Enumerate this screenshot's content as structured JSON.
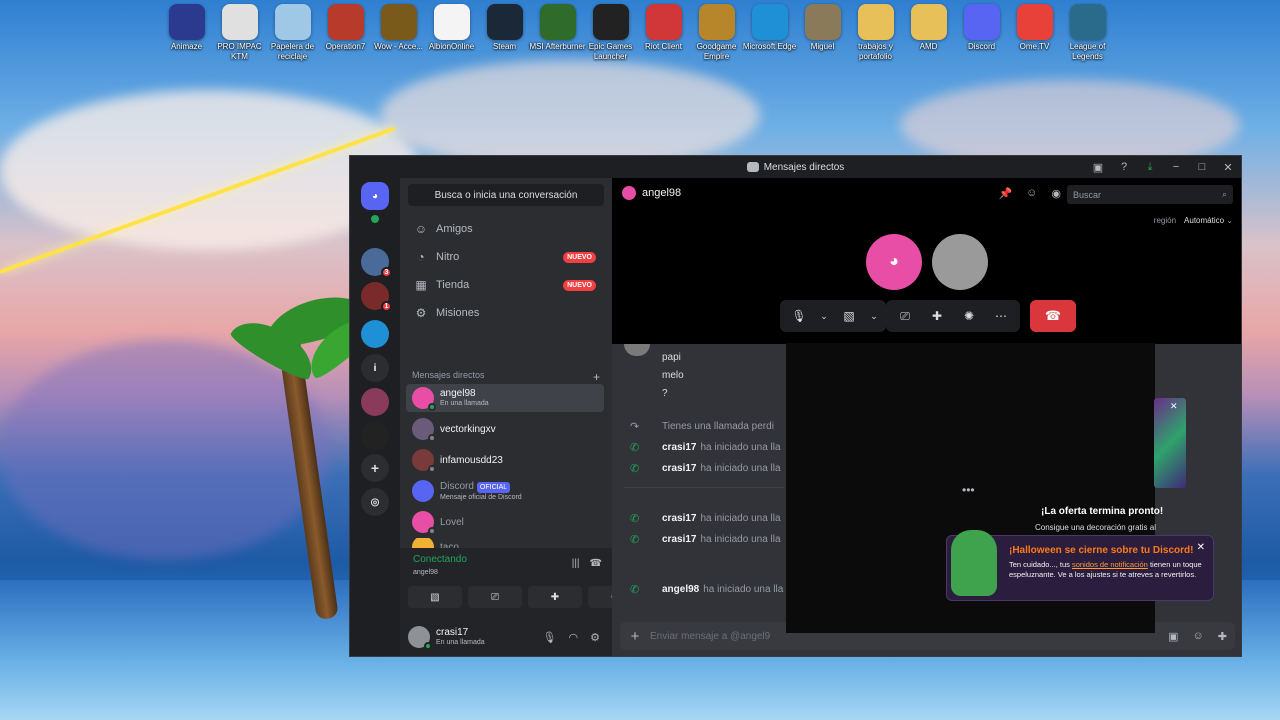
{
  "desktop_icons": [
    {
      "label": "Animaze",
      "icon": "animaze-icon",
      "color": "#2b3a8f"
    },
    {
      "label": "PRO IMPAC KTM",
      "icon": "document-icon",
      "color": "#e0e0e0"
    },
    {
      "label": "Papelera de reciclaje",
      "icon": "recycle-bin-icon",
      "color": "#9fc7e6"
    },
    {
      "label": "Operation7",
      "icon": "operation7-icon",
      "color": "#b83a2a"
    },
    {
      "label": "Wow - Acce...",
      "icon": "wow-icon",
      "color": "#7a5a1a"
    },
    {
      "label": "AlbionOnline",
      "icon": "file-icon",
      "color": "#f4f4f4"
    },
    {
      "label": "Steam",
      "icon": "steam-icon",
      "color": "#1b2838"
    },
    {
      "label": "MSI Afterburner",
      "icon": "msi-icon",
      "color": "#2f6b2a"
    },
    {
      "label": "Epic Games Launcher",
      "icon": "epic-icon",
      "color": "#222222"
    },
    {
      "label": "Riot Client",
      "icon": "riot-icon",
      "color": "#d13639"
    },
    {
      "label": "Goodgame Empire",
      "icon": "goodgame-icon",
      "color": "#b8862a"
    },
    {
      "label": "Microsoft Edge",
      "icon": "edge-icon",
      "color": "#1f8fd6"
    },
    {
      "label": "Miguel",
      "icon": "folder-photo-icon",
      "color": "#8a7a5a"
    },
    {
      "label": "trabajos y portafolio",
      "icon": "folder-icon",
      "color": "#e8c05a"
    },
    {
      "label": "AMD",
      "icon": "folder-icon",
      "color": "#e8c05a"
    },
    {
      "label": "Discord",
      "icon": "discord-icon",
      "color": "#5865f2"
    },
    {
      "label": "Ome.TV",
      "icon": "ometv-icon",
      "color": "#e8413a"
    },
    {
      "label": "League of Legends",
      "icon": "lol-icon",
      "color": "#2a6a8a"
    }
  ],
  "window": {
    "title": "Mensajes directos",
    "controls": {
      "minimize": "−",
      "maximize": "□",
      "close": "✕"
    }
  },
  "dm_sidebar": {
    "search": "Busca o inicia una conversación",
    "nav": [
      {
        "label": "Amigos",
        "icon": "friends-icon",
        "badge": ""
      },
      {
        "label": "Nitro",
        "icon": "nitro-icon",
        "badge": "NUEVO"
      },
      {
        "label": "Tienda",
        "icon": "shop-icon",
        "badge": "NUEVO"
      },
      {
        "label": "Misiones",
        "icon": "quests-icon",
        "badge": ""
      }
    ],
    "section_title": "Mensajes directos",
    "add": "+",
    "dms": [
      {
        "name": "angel98",
        "sub": "En una llamada",
        "color": "#e94ea6"
      },
      {
        "name": "vectorkingxv",
        "sub": "",
        "color": "#6b5b7a"
      },
      {
        "name": "infamousdd23",
        "sub": "",
        "color": "#7a3a3a"
      },
      {
        "name": "Discord",
        "sub": "Mensaje oficial de Discord",
        "color": "#5865f2",
        "tag": "OFICIAL"
      },
      {
        "name": "Lovel",
        "sub": "",
        "color": "#e94ea6"
      },
      {
        "name": "taco",
        "sub": "",
        "color": "#f0b232"
      }
    ]
  },
  "rail": {
    "badges": [
      "3",
      "1"
    ],
    "dm_indicator": "i"
  },
  "voice": {
    "status": "Conectando",
    "channel": "angel98"
  },
  "user": {
    "name": "crasi17",
    "status": "En una llamada"
  },
  "channel": {
    "name": "angel98"
  },
  "search_placeholder": "Buscar",
  "region": {
    "label": "región",
    "value": "Automático"
  },
  "messages": [
    "papi",
    "melo",
    "?"
  ],
  "system_messages": [
    {
      "user": "",
      "text": "Tienes una llamada perdi",
      "missed": true
    },
    {
      "user": "crasi17",
      "text": "ha iniciado una lla"
    },
    {
      "user": "crasi17",
      "text": "ha iniciado una lla"
    },
    {
      "user": "crasi17",
      "text": "ha iniciado una lla"
    },
    {
      "user": "crasi17",
      "text": "ha iniciado una lla"
    },
    {
      "user": "angel98",
      "text": "ha iniciado una lla"
    }
  ],
  "composer_placeholder": "Enviar mensaje a @angel9",
  "promo": {
    "title": "¡La oferta termina pronto!",
    "subtitle": "Consigue una decoración gratis al"
  },
  "halloween": {
    "title": "¡Halloween se cierne sobre tu Discord!",
    "text_pre": "Ten cuidado..., tus ",
    "link": "sonidos de notificación",
    "text_post": " tienen un toque espeluznante. Ve a los ajustes si te atreves a revertirlos."
  },
  "colors": {
    "accent": "#5865f2",
    "online": "#23a55a",
    "danger": "#da373c",
    "badge": "#f23f43"
  }
}
